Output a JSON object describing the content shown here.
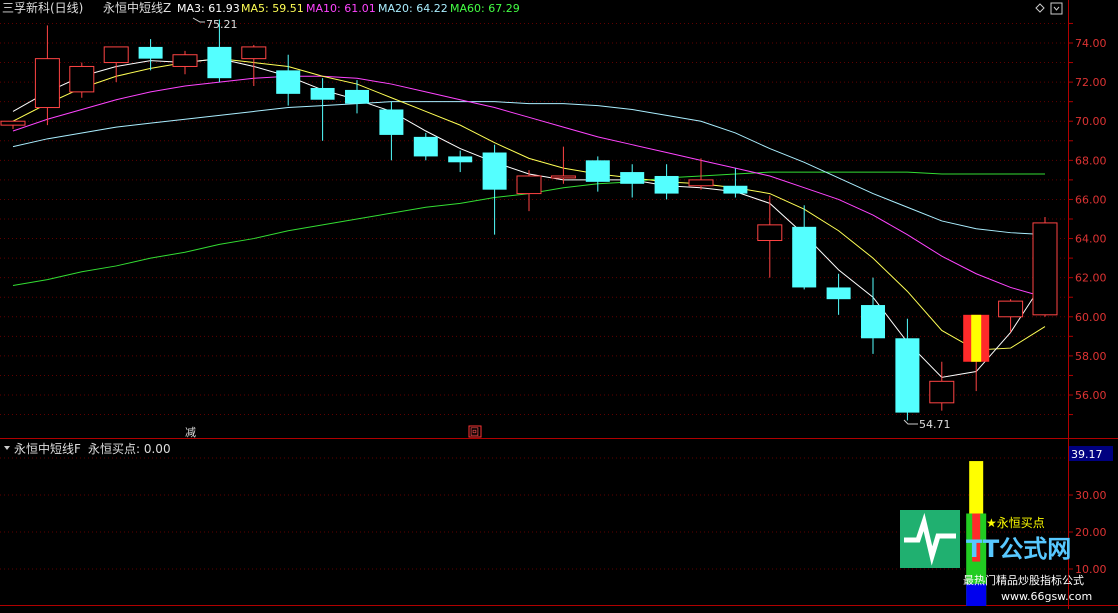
{
  "main_panel": {
    "title": "三孚新科(日线)",
    "indicator_name": "永恒中短线Z",
    "legend": [
      {
        "label": "MA3: 61.93",
        "color": "#ffffff"
      },
      {
        "label": "MA5: 59.51",
        "color": "#ffff55"
      },
      {
        "label": "MA10: 61.01",
        "color": "#ff44ff"
      },
      {
        "label": "MA20: 64.22",
        "color": "#aaeeff"
      },
      {
        "label": "MA60: 67.29",
        "color": "#44ff44"
      }
    ],
    "price_ticks": [
      "74.00",
      "72.00",
      "70.00",
      "68.00",
      "66.00",
      "64.00",
      "62.00",
      "60.00",
      "58.00",
      "56.00"
    ],
    "high_label": "75.21",
    "low_label": "54.71",
    "marker_jian": "减",
    "marker_box": "回"
  },
  "sub_panel": {
    "title": "永恒中短线F",
    "field": "永恒买点: 0.00",
    "ticks": [
      "30.00",
      "20.00",
      "10.00"
    ],
    "current_value": "39.17",
    "signal_label": "★永恒买点"
  },
  "watermark": {
    "brand": "TT公式网",
    "slogan": "最热门精品炒股指标公式",
    "url": "www.66gsw.com"
  },
  "chart_data": {
    "type": "candlestick",
    "y_range": [
      55,
      75.5
    ],
    "candles": [
      [
        69.8,
        70.0,
        69.8,
        69.6
      ],
      [
        70.7,
        73.2,
        74.9,
        69.8
      ],
      [
        71.5,
        72.8,
        73.0,
        71.2
      ],
      [
        73.0,
        73.8,
        73.8,
        72.0
      ],
      [
        73.8,
        73.2,
        74.2,
        72.6
      ],
      [
        72.8,
        73.4,
        73.6,
        72.4
      ],
      [
        73.8,
        72.2,
        75.2,
        72.0
      ],
      [
        73.2,
        73.8,
        73.9,
        71.8
      ],
      [
        72.6,
        71.4,
        73.4,
        70.8
      ],
      [
        71.7,
        71.1,
        72.2,
        69.0
      ],
      [
        71.6,
        70.9,
        72.1,
        70.4
      ],
      [
        70.6,
        69.3,
        71.0,
        68.0
      ],
      [
        69.2,
        68.2,
        69.4,
        68.0
      ],
      [
        68.2,
        67.9,
        68.5,
        67.4
      ],
      [
        68.4,
        66.5,
        68.8,
        64.2
      ],
      [
        66.3,
        67.2,
        67.5,
        65.4
      ],
      [
        67.1,
        67.2,
        68.7,
        66.8
      ],
      [
        68.0,
        66.9,
        68.2,
        66.4
      ],
      [
        67.4,
        66.8,
        67.8,
        66.1
      ],
      [
        67.2,
        66.3,
        67.8,
        66.0
      ],
      [
        66.7,
        67.0,
        68.1,
        66.5
      ],
      [
        66.7,
        66.3,
        67.6,
        66.1
      ],
      [
        63.9,
        64.7,
        66.2,
        62.0
      ],
      [
        64.6,
        61.5,
        65.7,
        61.4
      ],
      [
        61.5,
        60.9,
        62.2,
        60.1
      ],
      [
        60.6,
        58.9,
        62.0,
        58.1
      ],
      [
        58.9,
        55.1,
        59.9,
        54.7
      ],
      [
        55.6,
        56.7,
        57.7,
        55.2
      ],
      [
        57.8,
        60.0,
        60.0,
        56.2
      ],
      [
        60.0,
        60.8,
        60.9,
        59.2
      ],
      [
        60.1,
        64.8,
        65.1,
        60.0
      ]
    ],
    "ma3": [
      70.5,
      71.5,
      72.3,
      72.8,
      73.1,
      73.0,
      73.2,
      72.8,
      72.3,
      71.6,
      71.1,
      70.5,
      69.5,
      68.6,
      67.9,
      67.3,
      67.0,
      67.0,
      67.0,
      66.7,
      66.6,
      66.4,
      65.8,
      64.2,
      62.4,
      61.0,
      58.7,
      56.9,
      57.2,
      59.2,
      61.9
    ],
    "ma5": [
      70.0,
      70.9,
      71.7,
      72.3,
      72.7,
      73.0,
      73.2,
      73.0,
      72.8,
      72.3,
      71.9,
      71.2,
      70.5,
      69.8,
      68.9,
      68.1,
      67.6,
      67.3,
      67.1,
      66.9,
      66.8,
      66.6,
      66.3,
      65.5,
      64.4,
      63.0,
      61.3,
      59.3,
      58.3,
      58.4,
      59.5
    ],
    "ma10": [
      69.5,
      70.1,
      70.6,
      71.1,
      71.5,
      71.8,
      72.0,
      72.2,
      72.3,
      72.3,
      72.2,
      71.9,
      71.5,
      71.1,
      70.7,
      70.2,
      69.7,
      69.2,
      68.8,
      68.4,
      68.0,
      67.6,
      67.2,
      66.6,
      66.0,
      65.2,
      64.2,
      63.1,
      62.2,
      61.5,
      61.0
    ],
    "ma20": [
      68.7,
      69.1,
      69.4,
      69.7,
      69.9,
      70.1,
      70.3,
      70.5,
      70.7,
      70.8,
      70.9,
      71.0,
      71.0,
      71.0,
      71.0,
      70.9,
      70.9,
      70.8,
      70.6,
      70.3,
      70.0,
      69.4,
      68.6,
      67.9,
      67.1,
      66.3,
      65.6,
      64.9,
      64.5,
      64.3,
      64.2
    ],
    "ma60": [
      61.6,
      61.9,
      62.3,
      62.6,
      63.0,
      63.3,
      63.7,
      64.0,
      64.4,
      64.7,
      65.0,
      65.3,
      65.6,
      65.8,
      66.1,
      66.3,
      66.6,
      66.8,
      66.9,
      67.1,
      67.2,
      67.3,
      67.4,
      67.4,
      67.4,
      67.4,
      67.4,
      67.3,
      67.3,
      67.3,
      67.3
    ],
    "sub_range": [
      0,
      39.17
    ],
    "sub_signal_index": 28
  }
}
